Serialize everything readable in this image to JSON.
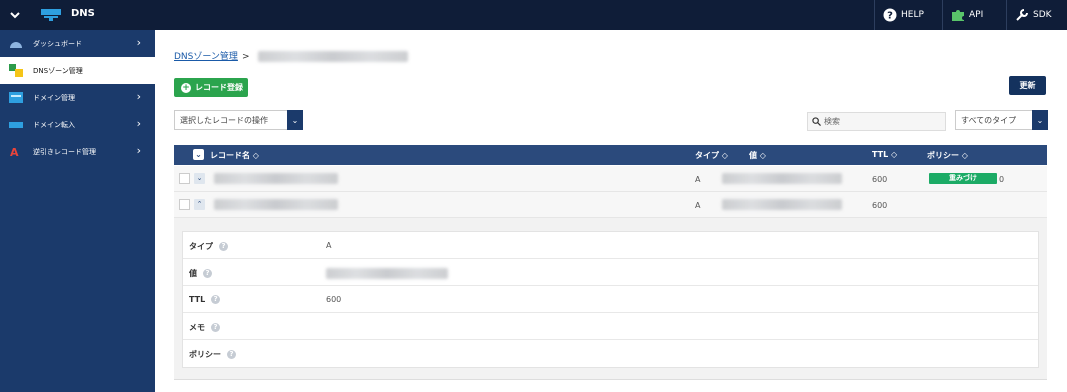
{
  "topbar": {
    "app_title": "DNS",
    "links": [
      {
        "label": "HELP",
        "icon": "help-icon"
      },
      {
        "label": "API",
        "icon": "puzzle-icon"
      },
      {
        "label": "SDK",
        "icon": "wrench-icon"
      }
    ]
  },
  "sidebar": {
    "items": [
      {
        "label": "ダッシュボード",
        "icon": "dashboard-icon",
        "active": false
      },
      {
        "label": "DNSゾーン管理",
        "icon": "dns-zone-icon",
        "active": true
      },
      {
        "label": "ドメイン管理",
        "icon": "domain-icon",
        "active": false
      },
      {
        "label": "ドメイン転入",
        "icon": "domain-transfer-icon",
        "active": false
      },
      {
        "label": "逆引きレコード管理",
        "icon": "reverse-record-icon",
        "active": false
      }
    ]
  },
  "breadcrumb": {
    "link": "DNSゾーン管理",
    "separator": ">"
  },
  "toolbar": {
    "add_label": "レコード登録",
    "refresh_label": "更新",
    "bulk_action": "選択したレコードの操作",
    "search_placeholder": "検索",
    "type_filter": "すべてのタイプ"
  },
  "table": {
    "headers": {
      "name": "レコード名 ◇",
      "type": "タイプ ◇",
      "value": "値 ◇",
      "ttl": "TTL ◇",
      "policy": "ポリシー ◇"
    },
    "rows": [
      {
        "type": "A",
        "ttl": "600",
        "policy_badge": "重みづけ",
        "policy_value": "0"
      },
      {
        "type": "A",
        "ttl": "600"
      }
    ]
  },
  "detail": {
    "rows": [
      {
        "key": "タイプ",
        "value": "A"
      },
      {
        "key": "値",
        "value": ""
      },
      {
        "key": "TTL",
        "value": "600"
      },
      {
        "key": "メモ",
        "value": ""
      },
      {
        "key": "ポリシー",
        "value": ""
      }
    ]
  },
  "colors": {
    "topbar": "#0f1d38",
    "sidebar": "#1b3a6b",
    "add_button": "#2ba44d",
    "badge": "#1cab66",
    "table_header": "#2b4a7c"
  }
}
